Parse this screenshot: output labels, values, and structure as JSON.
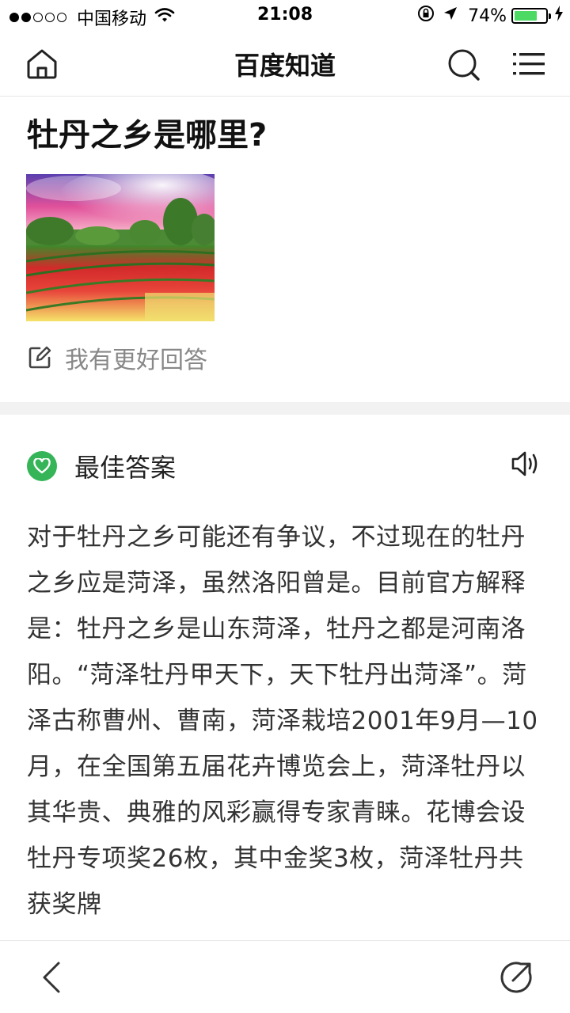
{
  "status_bar": {
    "carrier": "中国移动",
    "time": "21:08",
    "battery_percent": "74%",
    "battery_level": 0.74,
    "signal_bars_filled": 2,
    "signal_bars_total": 5,
    "icons": [
      "wifi-icon",
      "rotation-lock-icon",
      "location-arrow-icon",
      "battery-icon",
      "charging-bolt-icon"
    ]
  },
  "header": {
    "title": "百度知道",
    "icons": [
      "home-icon",
      "search-icon",
      "menu-icon"
    ]
  },
  "question": {
    "title": "牡丹之乡是哪里?",
    "image_alt": "peony field photo"
  },
  "write_answer": {
    "label": "我有更好回答",
    "icon": "edit-icon"
  },
  "best_answer": {
    "label": "最佳答案",
    "icon": "heart-icon",
    "audio_icon": "speaker-icon",
    "text": "对于牡丹之乡可能还有争议，不过现在的牡丹之乡应是菏泽，虽然洛阳曾是。目前官方解释是：牡丹之乡是山东菏泽，牡丹之都是河南洛阳。“菏泽牡丹甲天下，天下牡丹出菏泽”。菏泽古称曹州、曹南，菏泽栽培2001年9月—10月，在全国第五届花卉博览会上，菏泽牡丹以其华贵、典雅的风彩赢得专家青睐。花博会设牡丹专项奖26枚，其中金奖3枚，菏泽牡丹共获奖牌"
  },
  "bottom_bar": {
    "icons": [
      "back-icon",
      "share-icon"
    ]
  },
  "colors": {
    "accent_green": "#35b558",
    "battery_green": "#4cd964",
    "text_gray": "#888888",
    "divider": "#f2f2f2"
  }
}
